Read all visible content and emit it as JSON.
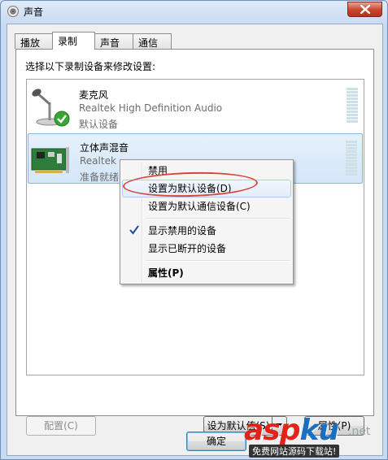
{
  "window": {
    "title": "声音"
  },
  "tabs": [
    {
      "label": "播放",
      "active": false
    },
    {
      "label": "录制",
      "active": true
    },
    {
      "label": "声音",
      "active": false
    },
    {
      "label": "通信",
      "active": false
    }
  ],
  "instruction": "选择以下录制设备来修改设置:",
  "devices": [
    {
      "name": "麦克风",
      "description": "Realtek High Definition Audio",
      "status": "默认设备",
      "icon": "microphone-icon",
      "selected": false
    },
    {
      "name": "立体声混音",
      "description": "Realtek",
      "status": "准备就绪",
      "icon": "sound-card-icon",
      "selected": true
    }
  ],
  "context_menu": {
    "items": [
      {
        "label": "禁用",
        "checked": false,
        "bold": false,
        "hover": false
      },
      {
        "label": "设置为默认设备(D)",
        "checked": false,
        "bold": false,
        "hover": true
      },
      {
        "label": "设置为默认通信设备(C)",
        "checked": false,
        "bold": false,
        "hover": false
      },
      {
        "label": "显示禁用的设备",
        "checked": true,
        "bold": false,
        "hover": false
      },
      {
        "label": "显示已断开的设备",
        "checked": false,
        "bold": false,
        "hover": false
      },
      {
        "label": "属性(P)",
        "checked": false,
        "bold": true,
        "hover": false
      }
    ]
  },
  "buttons": {
    "configure": "配置(C)",
    "set_default": "设为默认值(S)",
    "properties": "属性(P)",
    "ok": "确定"
  },
  "watermark": {
    "brand_asp": "asp",
    "brand_ku": "ku",
    "brand_suffix": ".net",
    "tagline": "免费网站源码下载站!"
  },
  "colors": {
    "highlight_ellipse": "#d9463b",
    "check_mark": "#1f4f9b",
    "default_badge": "#3aa437"
  }
}
